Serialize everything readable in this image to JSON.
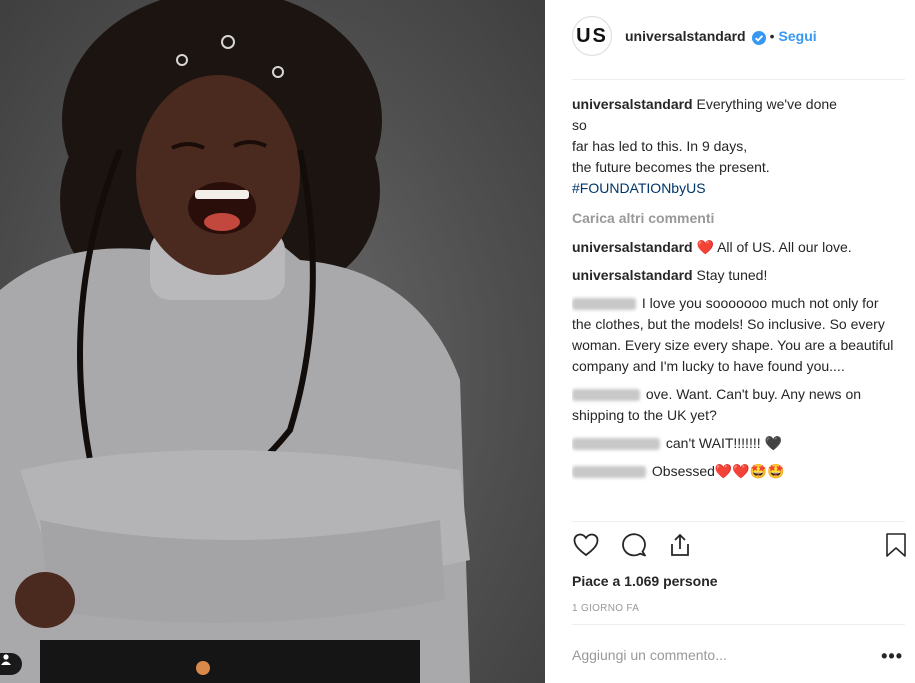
{
  "post": {
    "author": {
      "avatar_text": "US",
      "username": "universalstandard",
      "dot": "•",
      "follow_label": "Segui"
    },
    "caption": {
      "username": "universalstandard",
      "lines": [
        "Everything we've done",
        "so",
        "far has led to this. In 9 days,",
        "the future becomes the present."
      ],
      "hashtag": "#FOUNDATIONbyUS"
    },
    "load_more_label": "Carica altri commenti",
    "comments": [
      {
        "username": "universalstandard",
        "emoji": "❤️",
        "text": "All of US. All our love."
      },
      {
        "username": "universalstandard",
        "text": "Stay tuned!"
      },
      {
        "text": "I love you sooooooo much not only for the clothes, but the models! So inclusive. So every woman. Every size every shape. You are a beautiful company and I'm lucky to have found you...."
      },
      {
        "text": "ove. Want. Can't buy. Any news on shipping to the UK yet?"
      },
      {
        "text": "can't WAIT!!!!!!! 🖤"
      },
      {
        "text": "Obsessed❤️❤️🤩🤩"
      }
    ],
    "likes_text": "Piace a 1.069 persone",
    "time_text": "1 GIORNO FA",
    "add_comment_placeholder": "Aggiungi un commento...",
    "more_label": "•••"
  },
  "icons": [
    "heart-icon",
    "comment-icon",
    "share-icon",
    "bookmark-icon",
    "verified-icon",
    "user-tag-icon"
  ],
  "colors": {
    "accent": "#3897f0",
    "hashtag": "#003569",
    "heart": "#ed4956",
    "muted": "#999999",
    "border": "#efefef"
  }
}
